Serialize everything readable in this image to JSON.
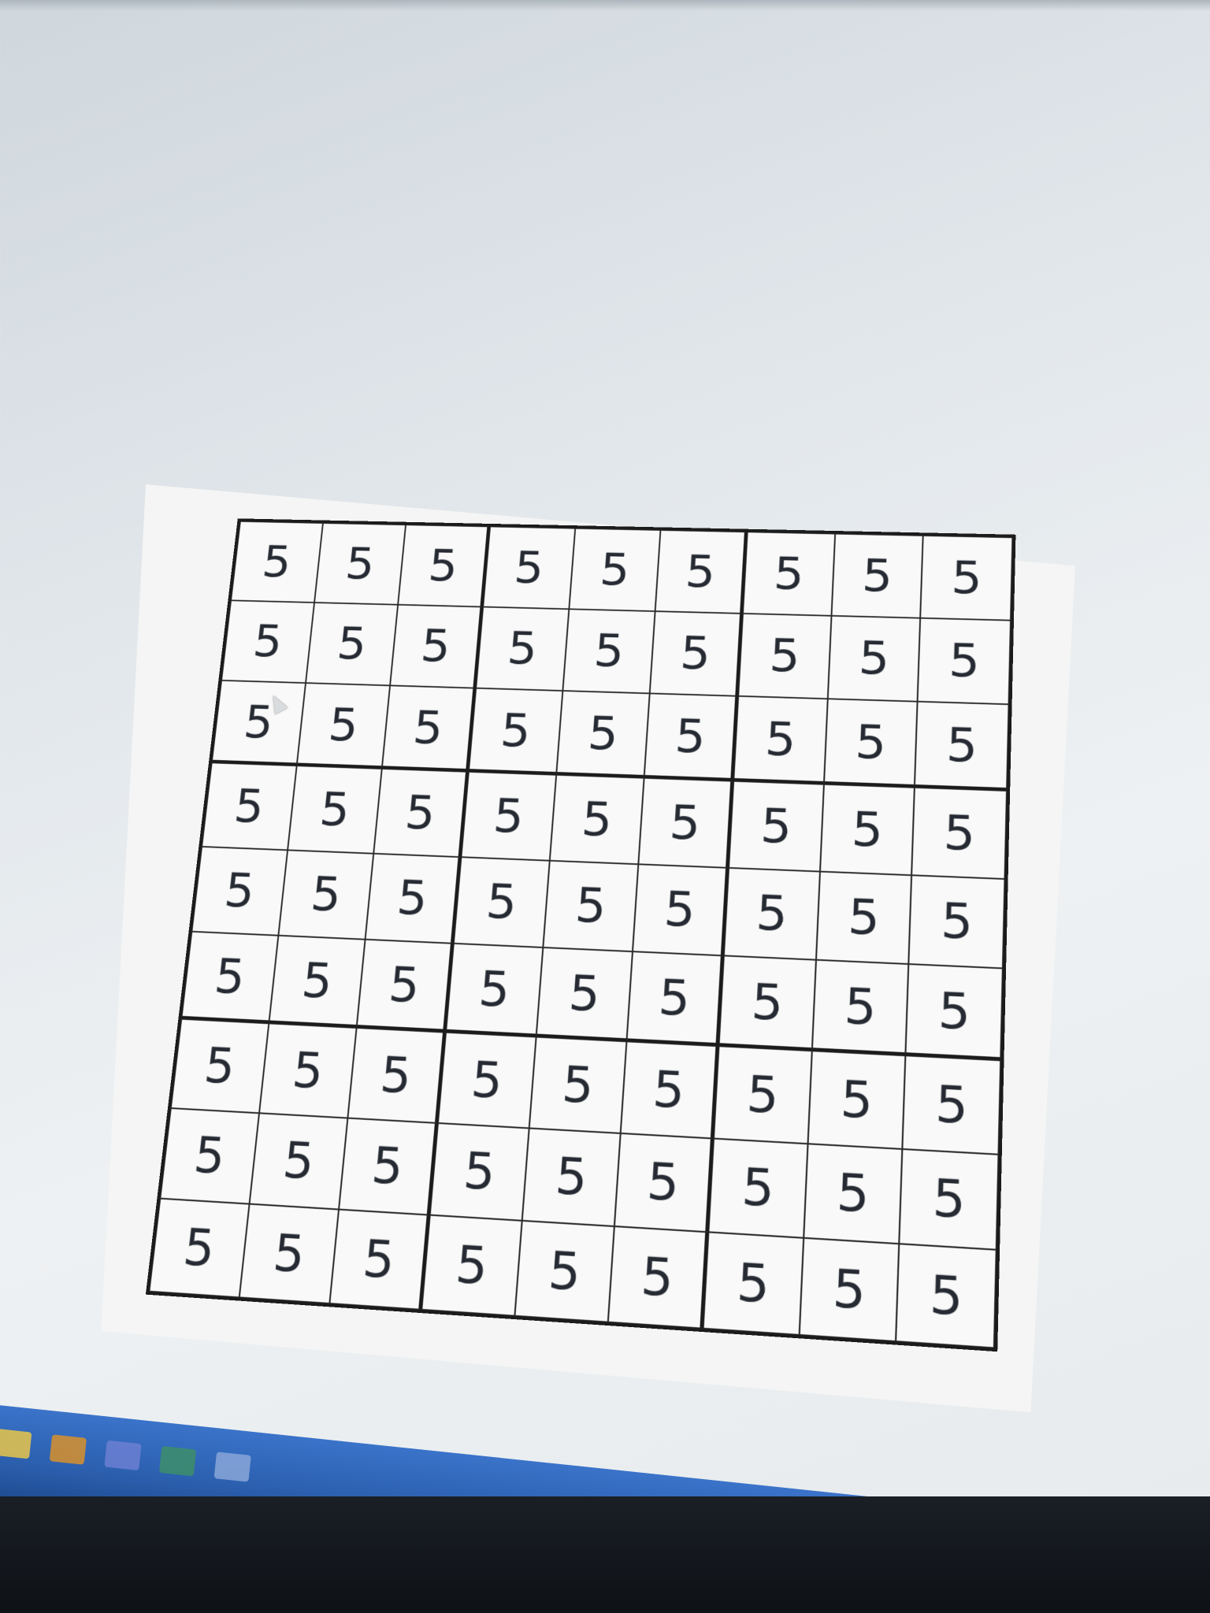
{
  "puzzle": {
    "rows": [
      [
        "5",
        "5",
        "5",
        "5",
        "5",
        "5",
        "5",
        "5",
        "5"
      ],
      [
        "5",
        "5",
        "5",
        "5",
        "5",
        "5",
        "5",
        "5",
        "5"
      ],
      [
        "5",
        "5",
        "5",
        "5",
        "5",
        "5",
        "5",
        "5",
        "5"
      ],
      [
        "5",
        "5",
        "5",
        "5",
        "5",
        "5",
        "5",
        "5",
        "5"
      ],
      [
        "5",
        "5",
        "5",
        "5",
        "5",
        "5",
        "5",
        "5",
        "5"
      ],
      [
        "5",
        "5",
        "5",
        "5",
        "5",
        "5",
        "5",
        "5",
        "5"
      ],
      [
        "5",
        "5",
        "5",
        "5",
        "5",
        "5",
        "5",
        "5",
        "5"
      ],
      [
        "5",
        "5",
        "5",
        "5",
        "5",
        "5",
        "5",
        "5",
        "5"
      ],
      [
        "5",
        "5",
        "5",
        "5",
        "5",
        "5",
        "5",
        "5",
        "5"
      ]
    ]
  },
  "taskbar": {
    "icons": [
      "app-icon-1",
      "app-icon-2",
      "app-icon-3",
      "app-icon-4",
      "app-icon-5"
    ]
  }
}
